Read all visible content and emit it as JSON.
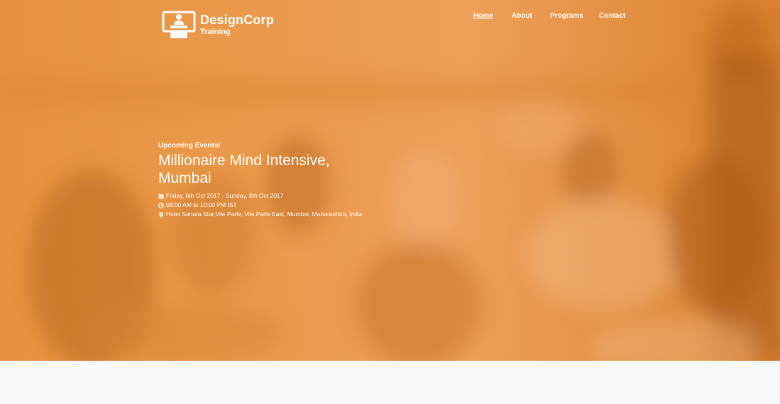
{
  "brand": {
    "title": "DesignCorp",
    "subtitle": "Training",
    "icon": "podium-speaker-icon"
  },
  "nav": {
    "items": [
      {
        "label": "Home",
        "active": true
      },
      {
        "label": "About",
        "active": false
      },
      {
        "label": "Programs",
        "active": false
      },
      {
        "label": "Contact",
        "active": false
      }
    ]
  },
  "event": {
    "breadcrumb": "Upcoming Events/",
    "title": "Millionaire Mind Intensive, Mumbai",
    "date": "Friday, 6th Oct 2017 - Sunday, 8th Oct 2017",
    "time": "08:00 AM to 10:00 PM IST",
    "location": "Hotel Sahara Star,Vile Parle, Vile Parle East, Mumbai, Maharashtra, India",
    "icons": {
      "date": "calendar-icon",
      "time": "clock-icon",
      "location": "map-marker-icon"
    }
  },
  "colors": {
    "overlay": "#e8943e",
    "text": "#ffffff",
    "below_bg": "#f9f9f9"
  }
}
